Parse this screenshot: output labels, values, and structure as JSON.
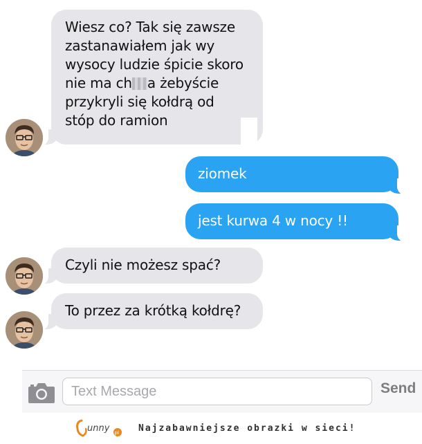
{
  "messages": [
    {
      "direction": "received",
      "lines": [
        "Wiesz co? Tak się zawsze",
        "zastanawiałem jak wy",
        "wysocy ludzie śpicie skoro",
        "nie ma ch",
        "a żebyście",
        "przykryli się kołdrą od",
        "stóp do ramion"
      ]
    },
    {
      "direction": "sent",
      "text": "ziomek"
    },
    {
      "direction": "sent",
      "text": "jest kurwa 4 w nocy !!"
    },
    {
      "direction": "received",
      "text": "Czyli nie możesz spać?"
    },
    {
      "direction": "received",
      "text": "To przez za krótką kołdrę?"
    }
  ],
  "compose": {
    "placeholder": "Text Message",
    "send_label": "Send"
  },
  "footer": {
    "logo_text": "funny",
    "logo_suffix": "pl",
    "tagline": "Najzabawniejsze obrazki w sieci!"
  },
  "colors": {
    "received_bubble": "#e5e5ea",
    "sent_bubble": "#2aa3f2",
    "send_text": "#7d7d82"
  }
}
